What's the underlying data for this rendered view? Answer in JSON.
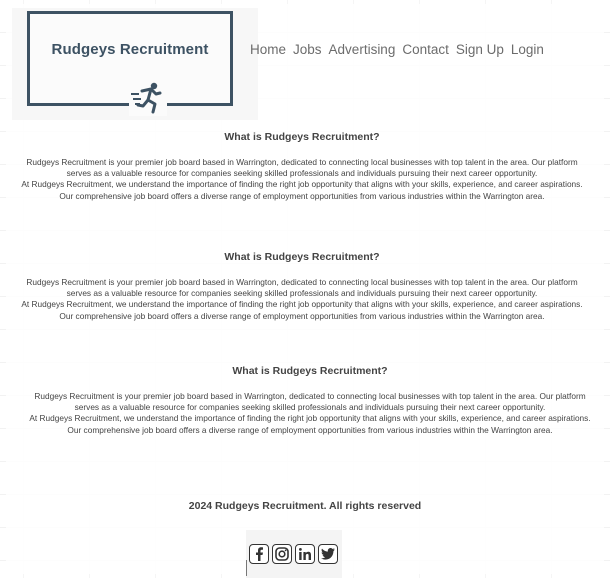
{
  "brand": {
    "name": "Rudgeys Recruitment",
    "accent": "#3d5263"
  },
  "nav": {
    "items": [
      "Home",
      "Jobs",
      "Advertising",
      "Contact",
      "Sign Up",
      "Login"
    ]
  },
  "sections": [
    {
      "heading": "What is Rudgeys Recruitment?",
      "para1": "Rudgeys Recruitment is your premier job board based in Warrington, dedicated to connecting local businesses with top talent in the area. Our platform serves as a valuable resource for companies seeking skilled professionals and individuals pursuing their next career opportunity.",
      "para2": "At Rudgeys Recruitment, we understand the importance of finding the right job opportunity that aligns with your skills, experience, and career aspirations. Our comprehensive job board offers a diverse range of employment opportunities from various industries within the Warrington area."
    },
    {
      "heading": "What is Rudgeys Recruitment?",
      "para1": "Rudgeys Recruitment is your premier job board based in Warrington, dedicated to connecting local businesses with top talent in the area. Our platform serves as a valuable resource for companies seeking skilled professionals and individuals pursuing their next career opportunity.",
      "para2": "At Rudgeys Recruitment, we understand the importance of finding the right job opportunity that aligns with your skills, experience, and career aspirations. Our comprehensive job board offers a diverse range of employment opportunities from various industries within the Warrington area."
    },
    {
      "heading": "What is Rudgeys Recruitment?",
      "para1": "Rudgeys Recruitment is your premier job board based in Warrington, dedicated to connecting local businesses with top talent in the area. Our platform serves as a valuable resource for companies seeking skilled professionals and individuals pursuing their next career opportunity.",
      "para2": "At Rudgeys Recruitment, we understand the importance of finding the right job opportunity that aligns with your skills, experience, and career aspirations. Our comprehensive job board offers a diverse range of employment opportunities from various industries within the Warrington area."
    }
  ],
  "footer": {
    "copyright": "2024 Rudgeys Recruitment. All rights reserved",
    "social": [
      "facebook-icon",
      "instagram-icon",
      "linkedin-icon",
      "twitter-icon"
    ]
  }
}
